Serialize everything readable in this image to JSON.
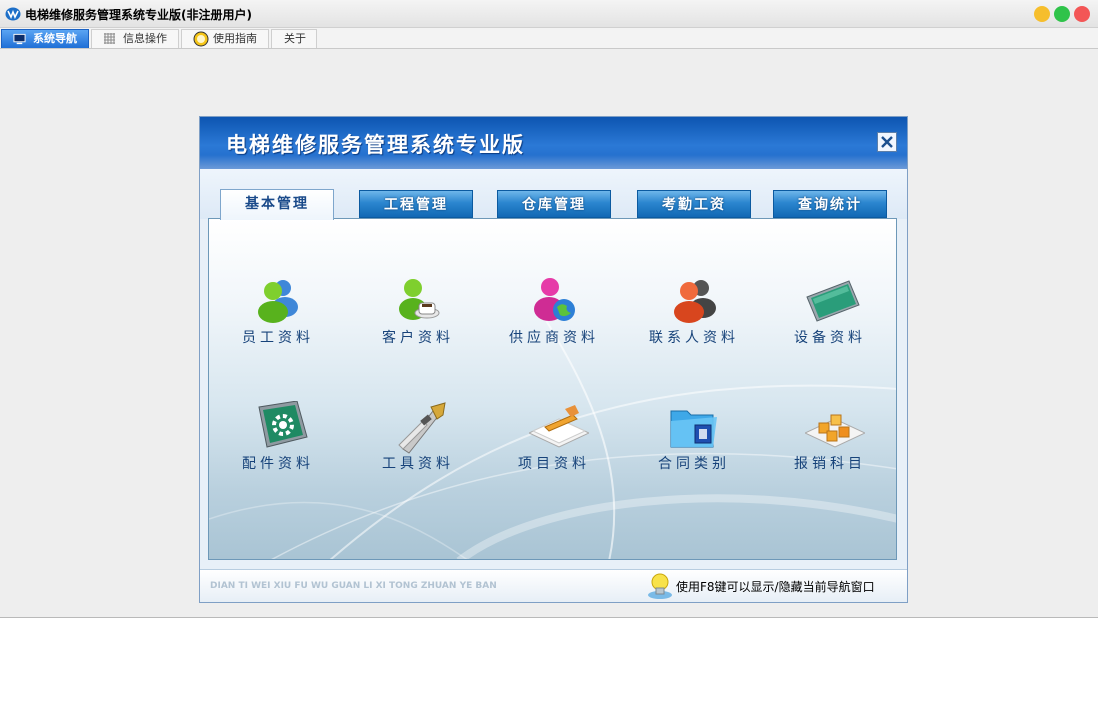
{
  "window": {
    "title": "电梯维修服务管理系统专业版(非注册用户)",
    "controls": {
      "minimize_color": "#f6be2c",
      "maximize_color": "#2fc34a",
      "close_color": "#f35656"
    }
  },
  "menu_tabs": [
    {
      "label": "系统导航",
      "icon": "monitor-icon",
      "active": true
    },
    {
      "label": "信息操作",
      "icon": "grid-icon",
      "active": false
    },
    {
      "label": "使用指南",
      "icon": "help-icon",
      "active": false
    },
    {
      "label": "关于",
      "icon": "",
      "active": false
    }
  ],
  "navigator": {
    "title": "电梯维修服务管理系统专业版",
    "tabs": [
      "基本管理",
      "工程管理",
      "仓库管理",
      "考勤工资",
      "查询统计"
    ],
    "active_tab": "基本管理",
    "modules": [
      {
        "label": "员工资料",
        "icon": "employee-icon"
      },
      {
        "label": "客户资料",
        "icon": "customer-icon"
      },
      {
        "label": "供应商资料",
        "icon": "supplier-icon"
      },
      {
        "label": "联系人资料",
        "icon": "contact-icon"
      },
      {
        "label": "设备资料",
        "icon": "equipment-icon"
      },
      {
        "label": "配件资料",
        "icon": "parts-icon"
      },
      {
        "label": "工具资料",
        "icon": "tools-icon"
      },
      {
        "label": "项目资料",
        "icon": "project-icon"
      },
      {
        "label": "合同类别",
        "icon": "contract-folder-icon"
      },
      {
        "label": "报销科目",
        "icon": "expense-icon"
      }
    ],
    "footer": {
      "pinyin": "DIAN TI WEI XIU FU WU GUAN LI XI TONG ZHUAN YE BAN",
      "tip": "使用F8键可以显示/隐藏当前导航窗口"
    },
    "colors": {
      "header_blue": "#1e66c4",
      "tab_blue": "#1168b4",
      "label_blue": "#17437a"
    }
  }
}
